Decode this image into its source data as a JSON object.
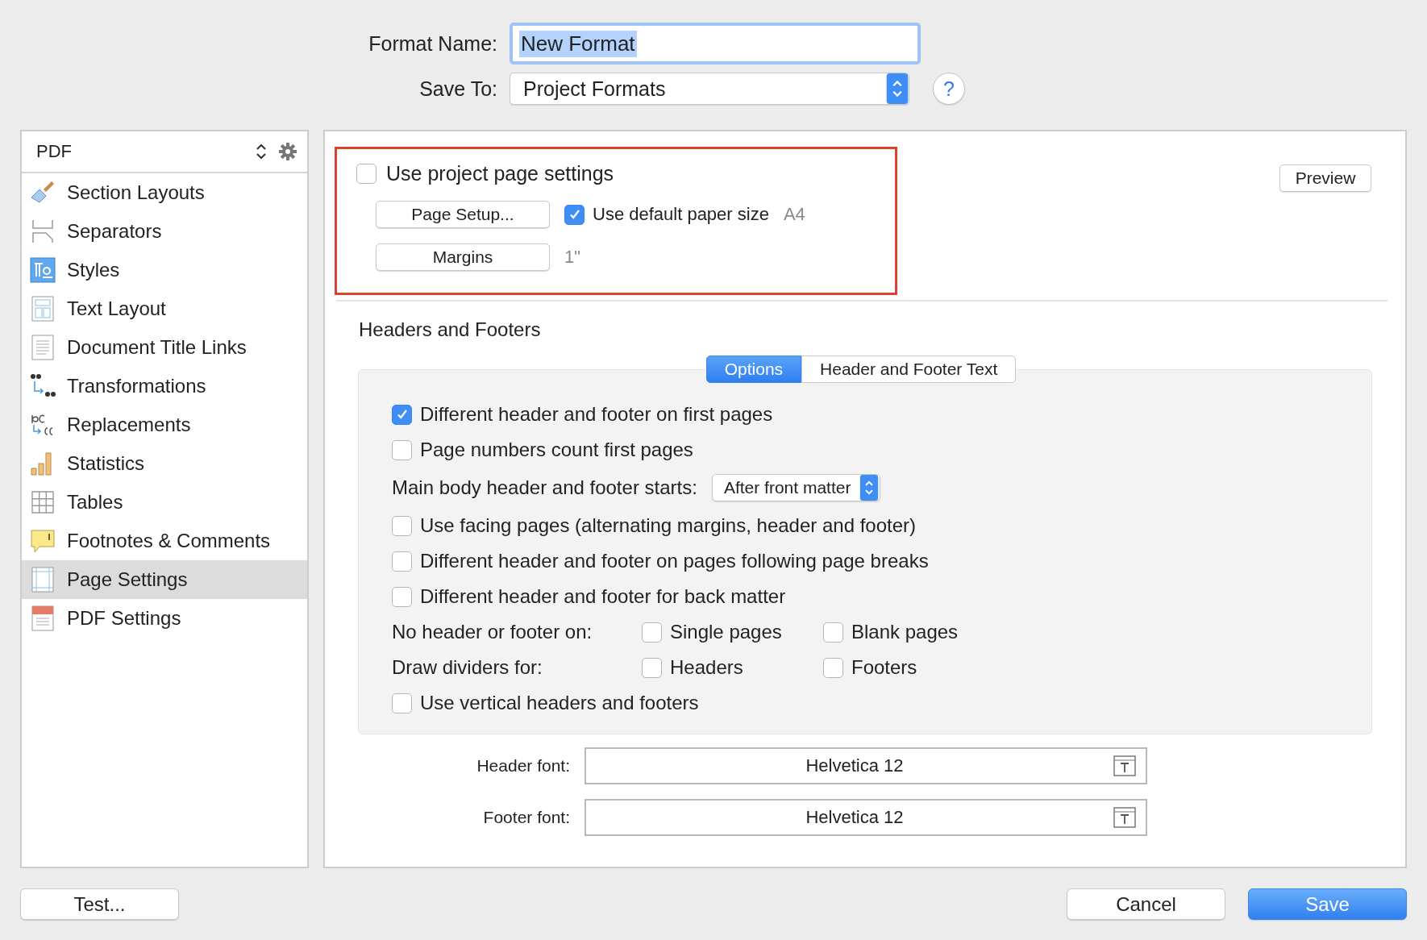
{
  "format_name": {
    "label": "Format Name:",
    "value": "New Format"
  },
  "save_to": {
    "label": "Save To:",
    "value": "Project Formats"
  },
  "help_button": "?",
  "sidebar": {
    "title": "PDF",
    "items": [
      {
        "label": "Section Layouts",
        "selected": false
      },
      {
        "label": "Separators",
        "selected": false
      },
      {
        "label": "Styles",
        "selected": false
      },
      {
        "label": "Text Layout",
        "selected": false
      },
      {
        "label": "Document Title Links",
        "selected": false
      },
      {
        "label": "Transformations",
        "selected": false
      },
      {
        "label": "Replacements",
        "selected": false
      },
      {
        "label": "Statistics",
        "selected": false
      },
      {
        "label": "Tables",
        "selected": false
      },
      {
        "label": "Footnotes & Comments",
        "selected": false
      },
      {
        "label": "Page Settings",
        "selected": true
      },
      {
        "label": "PDF Settings",
        "selected": false
      }
    ]
  },
  "page_settings": {
    "use_project": {
      "label": "Use project page settings",
      "checked": false
    },
    "page_setup_button": "Page Setup...",
    "default_paper": {
      "label": "Use default paper size",
      "checked": true
    },
    "paper_size": "A4",
    "margins_button": "Margins",
    "margins_value": "1\""
  },
  "preview_button": "Preview",
  "headers_footers": {
    "title": "Headers and Footers",
    "tabs": [
      {
        "label": "Options",
        "selected": true
      },
      {
        "label": "Header and Footer Text",
        "selected": false
      }
    ],
    "options": [
      {
        "kind": "checkbox",
        "label": "Different header and footer on first pages",
        "checked": true
      },
      {
        "kind": "checkbox",
        "label": "Page numbers count first pages",
        "checked": false
      },
      {
        "kind": "select",
        "label": "Main body header and footer starts:",
        "value": "After front matter"
      },
      {
        "kind": "checkbox",
        "label": "Use facing pages (alternating margins, header and footer)",
        "checked": false
      },
      {
        "kind": "checkbox",
        "label": "Different header and footer on pages following page breaks",
        "checked": false
      },
      {
        "kind": "checkbox",
        "label": "Different header and footer for back matter",
        "checked": false
      },
      {
        "kind": "group",
        "label": "No header or footer on:",
        "items": [
          {
            "label": "Single pages",
            "checked": false
          },
          {
            "label": "Blank pages",
            "checked": false
          }
        ]
      },
      {
        "kind": "group",
        "label": "Draw dividers for:",
        "items": [
          {
            "label": "Headers",
            "checked": false
          },
          {
            "label": "Footers",
            "checked": false
          }
        ]
      },
      {
        "kind": "checkbox",
        "label": "Use vertical headers and footers",
        "checked": false
      }
    ],
    "fonts": [
      {
        "label": "Header font:",
        "value": "Helvetica 12"
      },
      {
        "label": "Footer font:",
        "value": "Helvetica 12"
      }
    ]
  },
  "buttons": {
    "test": "Test...",
    "cancel": "Cancel",
    "save": "Save"
  }
}
